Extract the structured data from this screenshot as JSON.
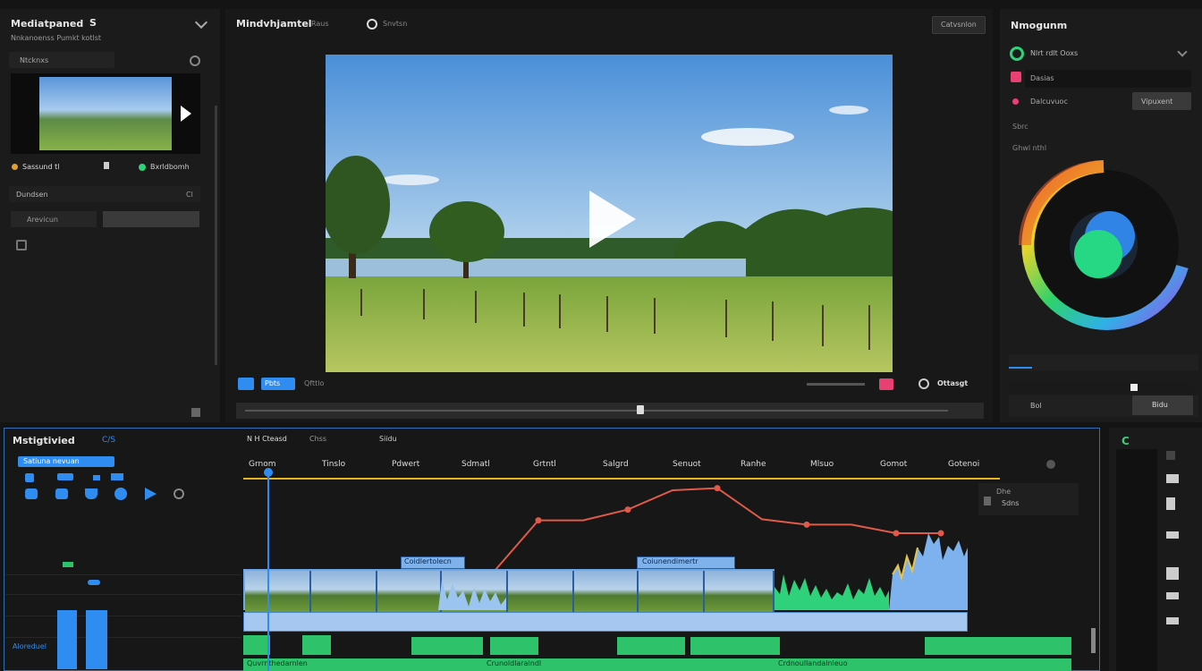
{
  "media_panel": {
    "title": "Mediatpaned",
    "header_icon": "S",
    "subtitle": "Nnkanoenss Pumkt kotlst",
    "row_label": "Ntcknxs",
    "clip_name": "Sassund tl",
    "clip_meta": "Bxrldbomh",
    "section": "Dundsen",
    "section_count": "Cl",
    "field_label": "Arevicun"
  },
  "viewer": {
    "title": "Mindvhjamtel",
    "tab": "Raus",
    "top_button": "Catvsnlon",
    "speed_label": "Pbts",
    "timecode": "Qfttlo",
    "time_right": "Ottasgt"
  },
  "right_panel": {
    "title": "Nmogunm",
    "row1": "Nlrt rdlt Ooxs",
    "row2": "Dasias",
    "row3": "Dalcuvuoc",
    "row3_button": "Vipuxent",
    "row4": "Sbrc",
    "row5": "Ghwl nthl",
    "bottom_label": "Bol",
    "bottom_button": "Bidu"
  },
  "timeline": {
    "title": "Mstigtivied",
    "title_badge": "C/S",
    "highlight": "Satiuna nevuan",
    "header_a": "N H Cteasd",
    "header_b": "Chss",
    "header_c": "Siidu",
    "ruler_labels": [
      "Grnom",
      "Tinslo",
      "Pdwert",
      "Sdmatl",
      "Grtntl",
      "Salgrd",
      "Senuot",
      "Ranhe",
      "Mlsuo",
      "Gomot",
      "Gotenoi"
    ],
    "clip_label_1": "Coidlertolecn",
    "clip_label_2": "Coiunendimertr",
    "side_label": "Dhe",
    "side_value": "Sdns",
    "track_name": "Aloreduel",
    "audio_labels": [
      "Quvrnthedarnlen",
      "Crunoldlaralndl",
      "Crdnoullandalnleuo"
    ],
    "keyframe_values": [
      0.12,
      0.14,
      0.62,
      0.62,
      0.72,
      0.9,
      0.92,
      0.63,
      0.58,
      0.58,
      0.5,
      0.5
    ]
  },
  "right_strip": {
    "title": "C"
  },
  "colors": {
    "accent_blue": "#2f8cf0",
    "clip_blue": "#9cc4f0",
    "audio_green": "#2fd27a",
    "keyframe_red": "#e05a4a",
    "wheel_center": "#26d884",
    "wheel_inner": "#2f84e6"
  }
}
